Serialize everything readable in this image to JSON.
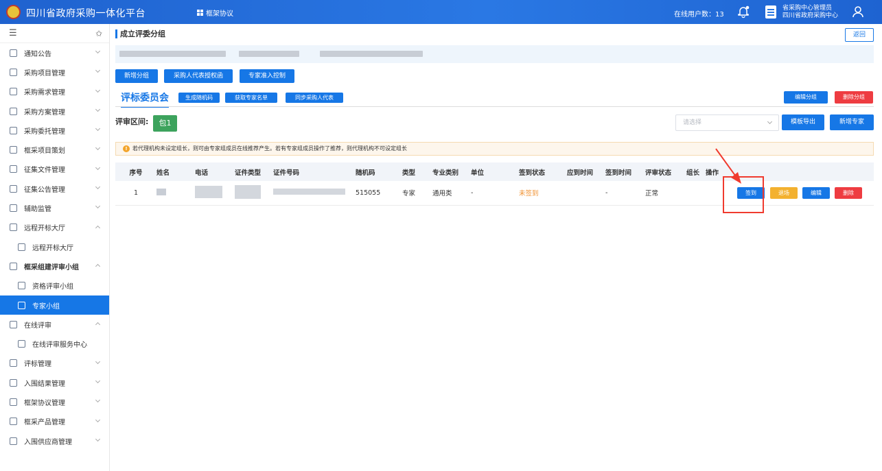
{
  "header": {
    "site_title": "四川省政府采购一体化平台",
    "tab_label": "框架协议",
    "online_users": "在线用户数：13",
    "user_role": "省采购中心管理员",
    "user_org": "四川省政府采购中心"
  },
  "sidebar": {
    "items": [
      {
        "label": "通知公告",
        "icon": "doc-icon"
      },
      {
        "label": "采购项目管理",
        "icon": "folder-icon"
      },
      {
        "label": "采购需求管理",
        "icon": "list-icon"
      },
      {
        "label": "采购方案管理",
        "icon": "clipboard-icon"
      },
      {
        "label": "采购委托管理",
        "icon": "clipboard-icon"
      },
      {
        "label": "框采项目策划",
        "icon": "folder-icon"
      },
      {
        "label": "征集文件管理",
        "icon": "file-icon"
      },
      {
        "label": "征集公告管理",
        "icon": "file-icon"
      },
      {
        "label": "辅助监管",
        "icon": "monitor-icon"
      },
      {
        "label": "远程开标大厅",
        "icon": "hall-icon"
      },
      {
        "label": "远程开标大厅",
        "icon": "hall-icon"
      },
      {
        "label": "框采组建评审小组",
        "icon": "group-icon"
      },
      {
        "label": "资格评审小组",
        "icon": "group-icon"
      },
      {
        "label": "专家小组",
        "icon": "group-icon"
      },
      {
        "label": "在线评审",
        "icon": "review-icon"
      },
      {
        "label": "在线评审服务中心",
        "icon": "review-icon"
      },
      {
        "label": "评标管理",
        "icon": "list-icon"
      },
      {
        "label": "入围结果管理",
        "icon": "result-icon"
      },
      {
        "label": "框架协议管理",
        "icon": "agreement-icon"
      },
      {
        "label": "框采产品管理",
        "icon": "product-icon"
      },
      {
        "label": "入围供应商管理",
        "icon": "supplier-icon"
      }
    ]
  },
  "main": {
    "title": "成立评委分组",
    "back_label": "返回",
    "action_buttons": [
      "新增分组",
      "采购人代表授权函",
      "专家准入控制"
    ],
    "committee_tab": "评标委员会",
    "committee_buttons": [
      "生成随机码",
      "获取专家名单",
      "同步采购人代表"
    ],
    "edit_group": "编辑分组",
    "delete_group": "删除分组",
    "range_label": "评审区间:",
    "package": "包1",
    "select_placeholder": "请选择",
    "template_export": "模板导出",
    "add_expert": "新增专家",
    "notice": "若代理机构未设定组长，则可由专家组成员在线推荐产生。若有专家组成员操作了推荐，则代理机构不可设定组长"
  },
  "table": {
    "headers": [
      "序号",
      "姓名",
      "电话",
      "证件类型",
      "证件号码",
      "随机码",
      "类型",
      "专业类别",
      "单位",
      "签到状态",
      "应到时间",
      "签到时间",
      "评审状态",
      "组长",
      "操作"
    ],
    "rows": [
      {
        "index": "1",
        "random_code": "515055",
        "type": "专家",
        "category": "通用类",
        "unit": "-",
        "sign_status": "未签到",
        "due_time": "",
        "sign_time": "-",
        "review_status": "正常",
        "leader": ""
      }
    ],
    "row_actions": [
      "签到",
      "退场",
      "编辑",
      "删除"
    ]
  },
  "colors": {
    "primary": "#1677e6",
    "warning": "#f3b12f",
    "danger": "#ee3c41",
    "success": "#3da35d",
    "annotation": "#f03a2e"
  }
}
